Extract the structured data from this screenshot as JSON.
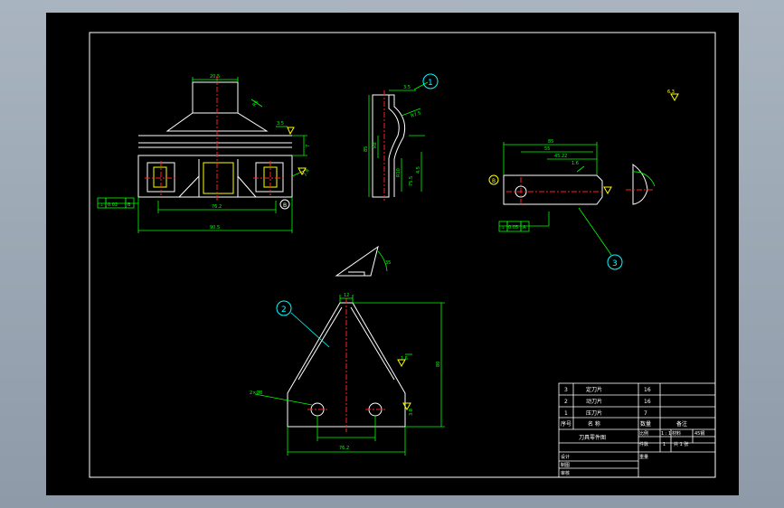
{
  "drawing": {
    "view_top": {
      "dims": [
        "20.5",
        "R6",
        "7",
        "3.5",
        "2.8",
        "76.2",
        "90.5"
      ],
      "tolerance": {
        "symbol": "⊥",
        "value": "0.02",
        "datum": "B"
      }
    },
    "view_side": {
      "dims": [
        "3.5",
        "R7.5",
        "R8",
        "85",
        "R10",
        "4.5",
        "75.5"
      ]
    },
    "view_right": {
      "dims": [
        "85",
        "55",
        "45.22",
        "1.6",
        "B"
      ],
      "tolerance": {
        "symbol": "⊥",
        "value": "0.05",
        "datum": "A"
      }
    },
    "view_small": {
      "dims": [
        "35"
      ]
    },
    "view_front": {
      "dims": [
        "12",
        "1.6",
        "80",
        "2×Ø6",
        "3.8",
        "76.2"
      ]
    },
    "roughness_global": "6.3",
    "balloons": [
      "1",
      "2",
      "3"
    ],
    "bom": {
      "rows": [
        {
          "no": "3",
          "name": "定刀片",
          "qty": "16"
        },
        {
          "no": "2",
          "name": "动刀片",
          "qty": "16"
        },
        {
          "no": "1",
          "name": "压刀片",
          "qty": "7"
        }
      ],
      "header": {
        "no": "序号",
        "name": "名 称",
        "qty": "数量",
        "note": "备注"
      },
      "title": "刀具零件图",
      "scale_label": "比例",
      "scale": "1 : 1",
      "material_label": "材料",
      "material": "45钢",
      "count_label": "件数",
      "count": "1",
      "sheet_label": "共 1 张",
      "designer": "设计",
      "drafter": "制图",
      "checker": "审核",
      "weight": "重量"
    }
  }
}
